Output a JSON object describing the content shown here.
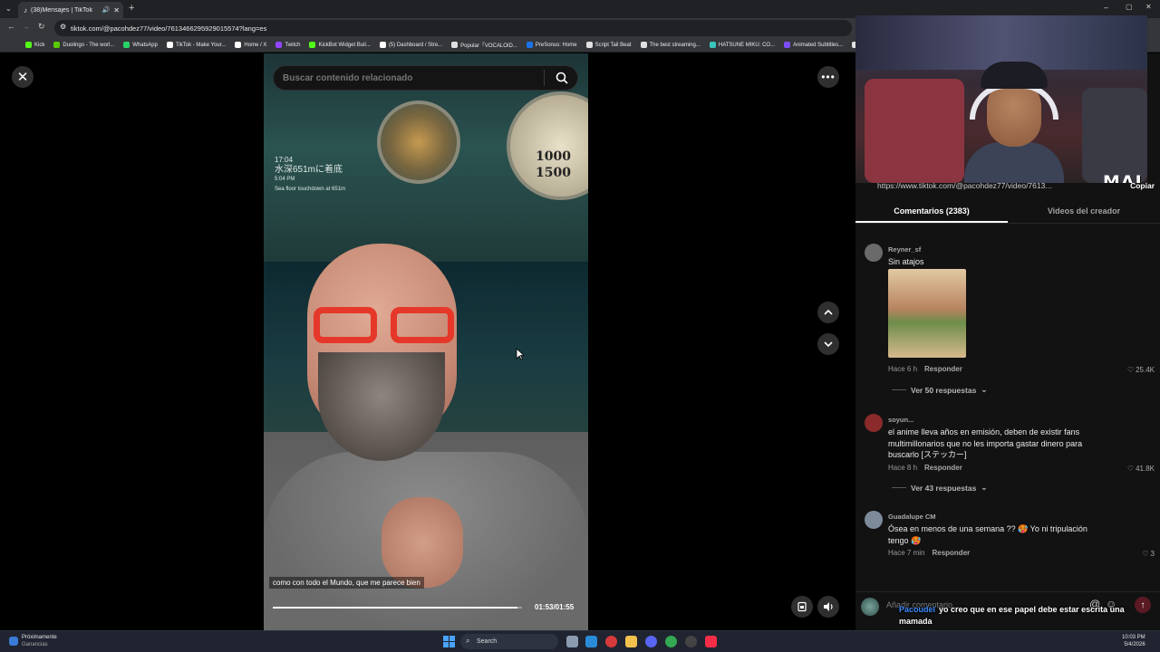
{
  "browser": {
    "tab_title": "(38)Mensajes | TikTok",
    "url": "tiktok.com/@pacohdez77/video/7613466295929015574?lang=es",
    "bookmarks": [
      {
        "label": "Kick",
        "color": "#53fc18"
      },
      {
        "label": "Duolingo - The worl...",
        "color": "#58cc02"
      },
      {
        "label": "WhatsApp",
        "color": "#25d366"
      },
      {
        "label": "TikTok - Make Your...",
        "color": "#ffffff"
      },
      {
        "label": "Home / X",
        "color": "#ffffff"
      },
      {
        "label": "Twitch",
        "color": "#9146ff"
      },
      {
        "label": "KickBot Widget Buil...",
        "color": "#53fc18"
      },
      {
        "label": "(5) Dashboard / Stre...",
        "color": "#ffffff"
      },
      {
        "label": "Popular「VOCALOID...",
        "color": "#e0e0e0"
      },
      {
        "label": "PreSonus: Home",
        "color": "#1a73e8"
      },
      {
        "label": "Script Tail Beat",
        "color": "#e0e0e0"
      },
      {
        "label": "The best streaming...",
        "color": "#e0e0e0"
      },
      {
        "label": "HATSUNE MIKU: CO...",
        "color": "#39c5bb"
      },
      {
        "label": "Animated Subtitles...",
        "color": "#7c4dff"
      },
      {
        "label": "HA",
        "color": "#e0e0e0"
      }
    ]
  },
  "video": {
    "search_placeholder": "Buscar contenido relacionado",
    "overlay_time": "17:04",
    "overlay_title": "水深651mに着底",
    "overlay_line2": "5:04 PM",
    "overlay_line3": "Sea floor touchdown at 651m",
    "gauge_numbers": "1000\n1500",
    "caption": "como con todo el Mundo, que me parece bien",
    "time": "01:53/01:55",
    "progress": 0.983
  },
  "panel": {
    "share_url": "https://www.tiktok.com/@pacohdez77/video/7613...",
    "copy_label": "Copiar",
    "tabs": [
      {
        "label": "Comentarios (2383)",
        "active": true
      },
      {
        "label": "Videos del creador",
        "active": false
      }
    ],
    "comments": [
      {
        "user": "Reyner_sf",
        "text": "Sin atajos",
        "time": "Hace 6 h",
        "reply": "Responder",
        "likes": "25.4K",
        "more": "Ver 50 respuestas",
        "avatar_color": "#6a6a6a"
      },
      {
        "user": "soyun...",
        "text": "el anime lleva años en emisión, deben de existir fans multimillonarios que no les importa gastar dinero para buscarlo [ステッカー]",
        "time": "Hace 8 h",
        "reply": "Responder",
        "likes": "41.8K",
        "more": "Ver 43 respuestas",
        "avatar_color": "#8a2a2a"
      },
      {
        "user": "Guadalupe CM",
        "text": "Ósea en menos de una semana ?? 🥵 Yo ni tripulación tengo 🥵",
        "time": "Hace 7 min",
        "reply": "Responder",
        "likes": "3",
        "avatar_color": "#7d8a9a"
      }
    ],
    "comment_placeholder": "Añadir comentario...",
    "at_symbol": "@",
    "emoji_symbol": "☺"
  },
  "chat_overlay": {
    "user": "Pacoudel",
    "message": "yo creo que en ese papel debe estar escrita una mamada"
  },
  "webcam": {
    "logo": "MAI"
  },
  "taskbar": {
    "weather_line1": "Próximamente",
    "weather_line2": "Ganancias",
    "search": "Search",
    "time": "10:03 PM",
    "date": "5/4/2026"
  }
}
